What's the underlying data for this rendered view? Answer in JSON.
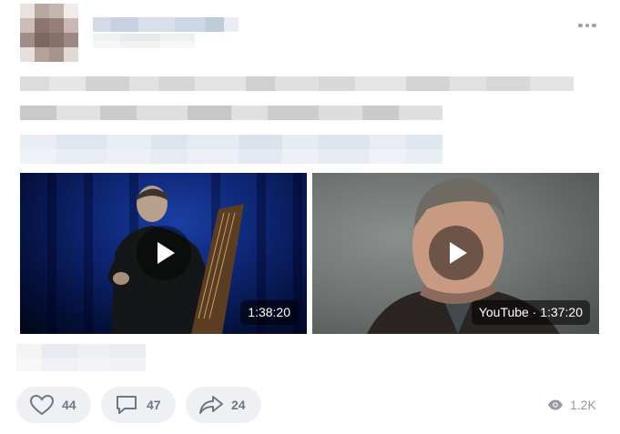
{
  "post": {
    "menu_icon": "more-horizontal-icon",
    "videos": [
      {
        "duration": "1:38:20",
        "icon": "play-icon"
      },
      {
        "duration": "YouTube · 1:37:20",
        "icon": "play-icon"
      }
    ],
    "actions": {
      "likes": "44",
      "comments": "47",
      "shares": "24",
      "views": "1.2K"
    },
    "icons": {
      "like": "heart-icon",
      "comment": "comment-icon",
      "share": "share-icon",
      "views": "eye-icon"
    },
    "colors": {
      "action_bg": "#eef0f3",
      "action_text": "#6d7885",
      "muted": "#939aa3"
    }
  }
}
